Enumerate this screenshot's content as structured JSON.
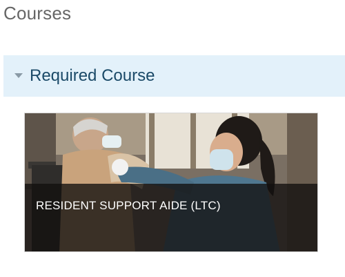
{
  "page": {
    "title": "Courses"
  },
  "section": {
    "title": "Required Course",
    "expanded": true
  },
  "courses": [
    {
      "name": "RESIDENT SUPPORT AIDE (LTC)"
    }
  ],
  "colors": {
    "section_bg": "#e3f1fa",
    "section_text": "#1b4a68",
    "overlay": "#12100e"
  }
}
